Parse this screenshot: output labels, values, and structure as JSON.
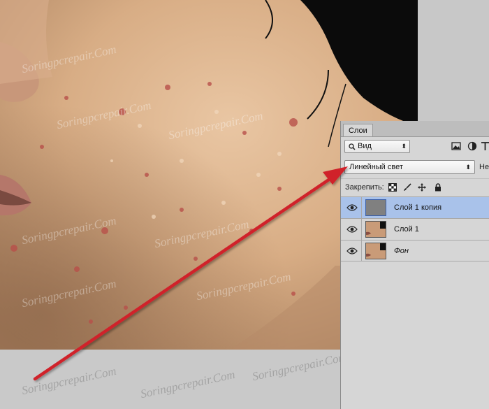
{
  "panel": {
    "tab_label": "Слои",
    "filter": {
      "selected": "Вид"
    },
    "blend_mode": {
      "selected": "Линейный свет"
    },
    "opacity_label_partial": "Неп",
    "lock_label": "Закрепить:"
  },
  "layers": [
    {
      "name": "Слой 1 копия",
      "selected": true,
      "thumbnail": "gray-fill"
    },
    {
      "name": "Слой 1",
      "selected": false,
      "thumbnail": "face-photo"
    },
    {
      "name": "Фон",
      "selected": false,
      "thumbnail": "face-photo"
    }
  ],
  "watermark": "Soringpcrepair.Com",
  "icons": [
    "search-icon",
    "image-filter-icon",
    "adjustment-filter-icon",
    "text-filter-icon",
    "lock-transparent-icon",
    "lock-brush-icon",
    "lock-move-icon",
    "lock-all-icon",
    "eye-icon"
  ],
  "colors": {
    "arrow": "#d0202a",
    "selection": "#a9c2ea",
    "panel": "#d6d6d6"
  }
}
